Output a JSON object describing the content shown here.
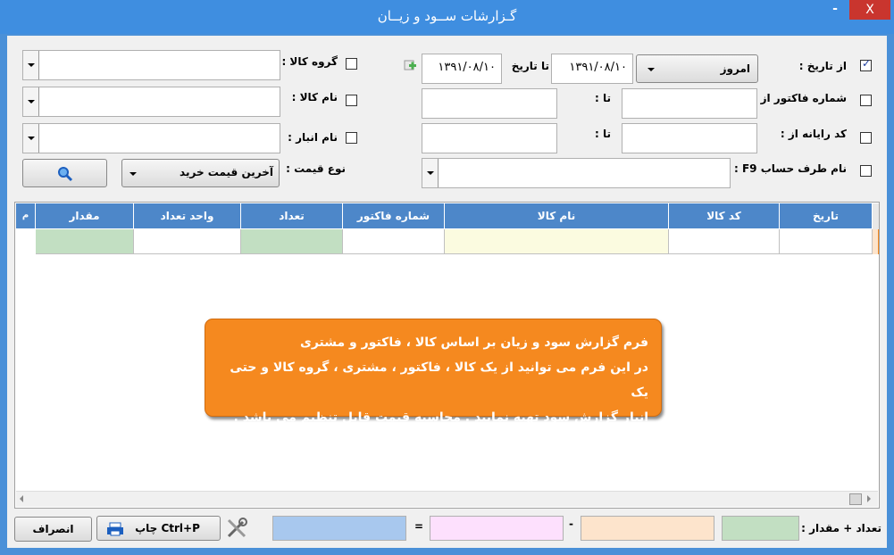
{
  "window": {
    "title": "گـزارشات ســود و زيــان",
    "minimize": "-",
    "close": "X"
  },
  "filters": {
    "date_from_label": "از تاريخ :",
    "date_preset": "امروز",
    "date_from_value": "۱۳۹۱/۰۸/۱۰",
    "date_to_label": "تا تاريخ",
    "date_to_value": "۱۳۹۱/۰۸/۱۰",
    "invoice_no_label": "شماره فاكتور  از :",
    "invoice_to_label": "تا :",
    "code_label": "كد رايانه از :",
    "code_to_label": "تا :",
    "account_label": "نام طرف حساب  F9 :",
    "product_group_label": "گروه كالا :",
    "product_name_label": "نام كالا :",
    "warehouse_label": "نام انبار :",
    "price_type_label": "نوع قيمت :",
    "price_type_value": "آخرين قيمت خريد"
  },
  "grid": {
    "columns": [
      "تاريخ",
      "كد كالا",
      "نام كالا",
      "شماره فاكتور",
      "تعداد",
      "واحد تعداد",
      "مقدار",
      "م"
    ]
  },
  "callout": {
    "line1": "فرم گزارش سود و زیان بر اساس کالا ، فاکتور و مشتری",
    "line2": "در این فرم می توانید از یک کالا ، فاکتور ، مشتری ، گروه کالا و حتی یک",
    "line3": "انبار گزارش سود تهیه نمایید . محاسبه قیمت قابل تنظیم می باشد ."
  },
  "footer": {
    "total_label": "تعداد + مقدار :",
    "minus": "-",
    "equals": "=",
    "print_label": "چاپ  Ctrl+P",
    "cancel_label": "انصراف"
  },
  "colors": {
    "header": "#4d87c9",
    "green": "#c2dfc2",
    "yellow": "#fbfbe0",
    "orange": "#f5891f",
    "peach": "#fde4cc",
    "pink": "#fde0fd",
    "blue": "#a8c8ee"
  }
}
